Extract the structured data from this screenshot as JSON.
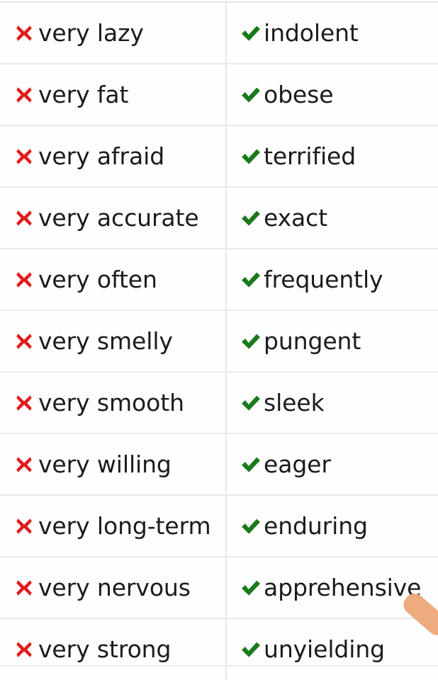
{
  "page": {
    "type": "comparison-table",
    "background_color": "#fdfdfd",
    "divider_color": "#eaeaea",
    "column_divider_color": "#e8e8e8"
  },
  "colors": {
    "cross_red": "#e01b1b",
    "check_green": "#1a7a1a",
    "text": "#1b1b1b",
    "pointer_peach": "#eeab7e"
  },
  "icons": {
    "wrong": "cross-mark-icon",
    "right": "check-mark-icon"
  },
  "table": {
    "rows": [
      {
        "wrong": "very lazy",
        "right": "indolent"
      },
      {
        "wrong": "very fat",
        "right": "obese"
      },
      {
        "wrong": "very afraid",
        "right": "terrified"
      },
      {
        "wrong": "very accurate",
        "right": "exact"
      },
      {
        "wrong": "very often",
        "right": "frequently"
      },
      {
        "wrong": "very smelly",
        "right": "pungent"
      },
      {
        "wrong": "very smooth",
        "right": "sleek"
      },
      {
        "wrong": "very willing",
        "right": "eager"
      },
      {
        "wrong": "very long-term",
        "right": "enduring"
      },
      {
        "wrong": "very nervous",
        "right": "apprehensive"
      },
      {
        "wrong": "very strong",
        "right": "unyielding"
      }
    ]
  },
  "overlay": {
    "pointer": "finger-pointer"
  }
}
